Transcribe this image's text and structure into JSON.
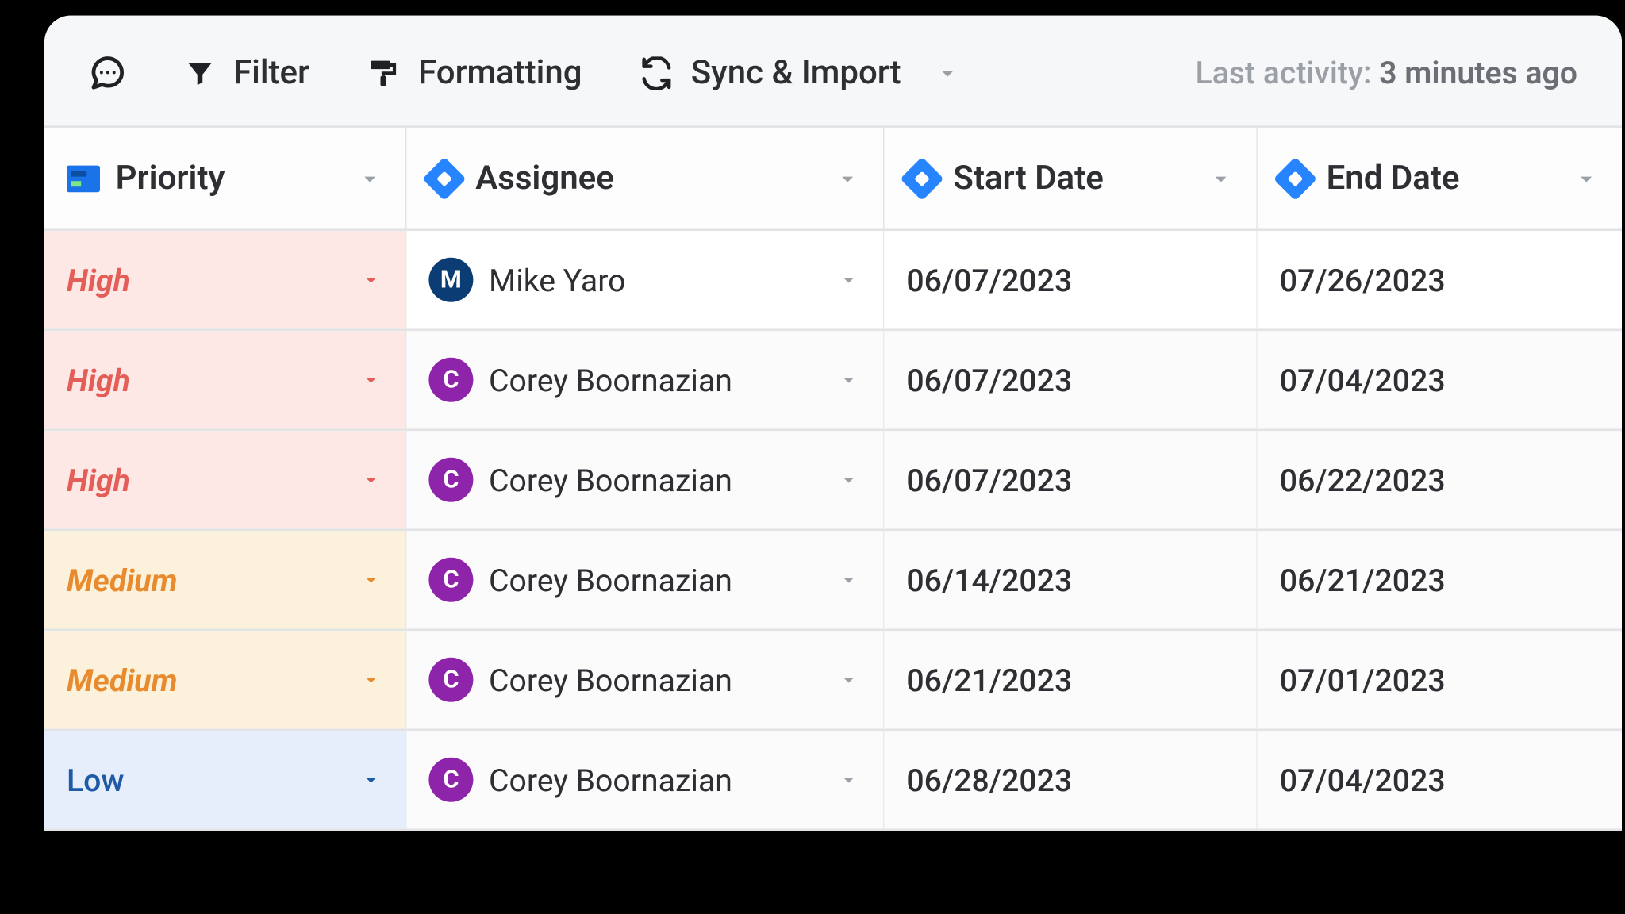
{
  "toolbar": {
    "filter_label": "Filter",
    "formatting_label": "Formatting",
    "sync_label": "Sync & Import",
    "last_activity_label": "Last activity: ",
    "last_activity_value": "3 minutes ago"
  },
  "columns": {
    "priority": "Priority",
    "assignee": "Assignee",
    "start_date": "Start Date",
    "end_date": "End Date"
  },
  "rows": [
    {
      "priority": "High",
      "priority_level": "high",
      "assignee": "Mike Yaro",
      "initial": "M",
      "start": "06/07/2023",
      "end": "07/26/2023"
    },
    {
      "priority": "High",
      "priority_level": "high",
      "assignee": "Corey Boornazian",
      "initial": "C",
      "start": "06/07/2023",
      "end": "07/04/2023"
    },
    {
      "priority": "High",
      "priority_level": "high",
      "assignee": "Corey Boornazian",
      "initial": "C",
      "start": "06/07/2023",
      "end": "06/22/2023"
    },
    {
      "priority": "Medium",
      "priority_level": "medium",
      "assignee": "Corey Boornazian",
      "initial": "C",
      "start": "06/14/2023",
      "end": "06/21/2023"
    },
    {
      "priority": "Medium",
      "priority_level": "medium",
      "assignee": "Corey Boornazian",
      "initial": "C",
      "start": "06/21/2023",
      "end": "07/01/2023"
    },
    {
      "priority": "Low",
      "priority_level": "low",
      "assignee": "Corey Boornazian",
      "initial": "C",
      "start": "06/28/2023",
      "end": "07/04/2023"
    }
  ]
}
